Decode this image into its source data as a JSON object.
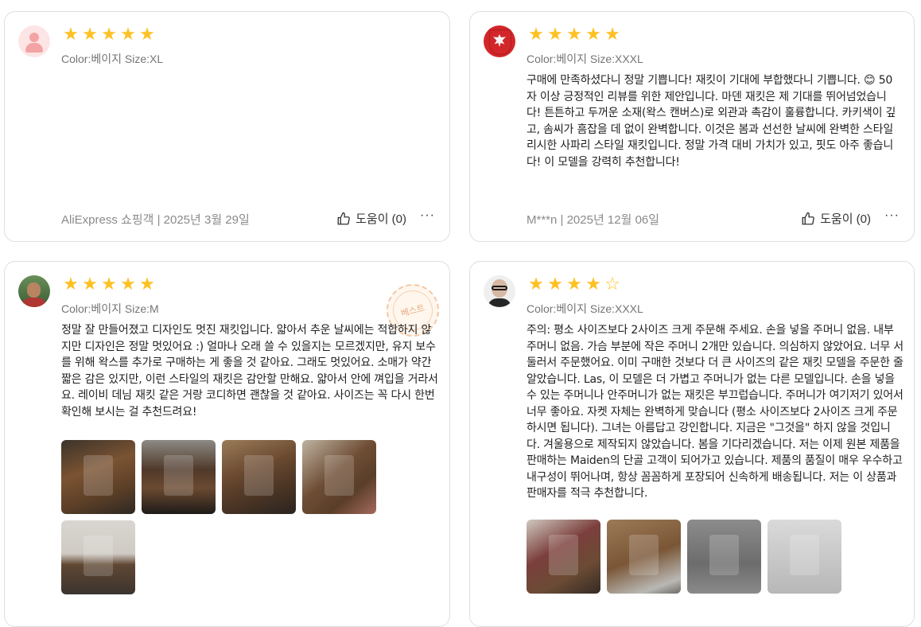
{
  "reviews": [
    {
      "avatar": "default-avatar",
      "rating": 5,
      "sku": "Color:베이지 Size:XL",
      "text": "",
      "meta": "AliExpress 쇼핑객 | 2025년 3월 29일",
      "helpful": "도움이 (0)"
    },
    {
      "avatar": "crest-avatar",
      "rating": 5,
      "sku": "Color:베이지 Size:XXXL",
      "text": "구매에 만족하셨다니 정말 기쁩니다! 재킷이 기대에 부합했다니 기쁩니다. 😊 50자 이상 긍정적인 리뷰를 위한 제안입니다. 마덴 재킷은 제 기대를 뛰어넘었습니다! 튼튼하고 두꺼운 소재(왁스 캔버스)로 외관과 촉감이 훌륭합니다. 카키색이 깊고, 솜씨가 흠잡을 데 없이 완벽합니다. 이것은 봄과 선선한 날씨에 완벽한 스타일리시한 사파리 스타일 재킷입니다. 정말 가격 대비 가치가 있고, 핏도 아주 좋습니다! 이 모델을 강력히 추천합니다!",
      "meta": "M***n | 2025년 12월 06일",
      "helpful": "도움이 (0)"
    },
    {
      "avatar": "user-photo-avatar",
      "rating": 5,
      "sku": "Color:베이지 Size:M",
      "badge": "베스트",
      "text": "정말 잘 만들어졌고 디자인도 멋진 재킷입니다. 얇아서 추운 날씨에는 적합하지 않지만 디자인은 정말 멋있어요 :) 얼마나 오래 쓸 수 있을지는 모르겠지만, 유지 보수를 위해 왁스를 추가로 구매하는 게 좋을 것 같아요. 그래도 멋있어요. 소매가 약간 짧은 감은 있지만, 이런 스타일의 재킷은 감안할 만해요. 얇아서 안에 껴입을 거라서요. 레이비 데님 재킷 같은 거랑 코디하면 괜찮을 것 같아요. 사이즈는 꼭 다시 한번 확인해 보시는 걸 추천드려요!",
      "photos": [
        "jacket-photo-1",
        "jacket-photo-2",
        "jacket-photo-3",
        "jacket-photo-4",
        "jacket-photo-5"
      ]
    },
    {
      "avatar": "user-photo-avatar",
      "rating": 4,
      "sku": "Color:베이지 Size:XXXL",
      "text": "주의: 평소 사이즈보다 2사이즈 크게 주문해 주세요. 손을 넣을 주머니 없음. 내부 주머니 없음. 가슴 부분에 작은 주머니 2개만 있습니다. 의심하지 않았어요. 너무 서둘러서 주문했어요. 이미 구매한 것보다 더 큰 사이즈의 같은 재킷 모델을 주문한 줄 알았습니다. Las, 이 모델은 더 가볍고 주머니가 없는 다른 모델입니다. 손을 넣을 수 있는 주머니나 안주머니가 없는 재킷은 부끄럽습니다. 주머니가 여기저기 있어서 너무 좋아요. 자켓 자체는 완벽하게 맞습니다 (평소 사이즈보다 2사이즈 크게 주문하시면 됩니다). 그녀는 아름답고 강인합니다. 지금은 \"그것을\" 하지 않을 것입니다. 겨울용으로 제작되지 않았습니다. 봄을 기다리겠습니다. 저는 이제 원본 제품을 판매하는 Maiden의 단골 고객이 되어가고 있습니다. 제품의 품질이 매우 우수하고 내구성이 뛰어나며, 항상 꼼꼼하게 포장되어 신속하게 배송됩니다. 저는 이 상품과 판매자를 적극 추천합니다.",
      "photos": [
        "jacket-photo-6",
        "jacket-photo-7",
        "package-photo-1",
        "package-photo-2"
      ]
    }
  ],
  "colors": {
    "star": "#fdc123",
    "border": "#dedede",
    "muted": "#757575"
  }
}
